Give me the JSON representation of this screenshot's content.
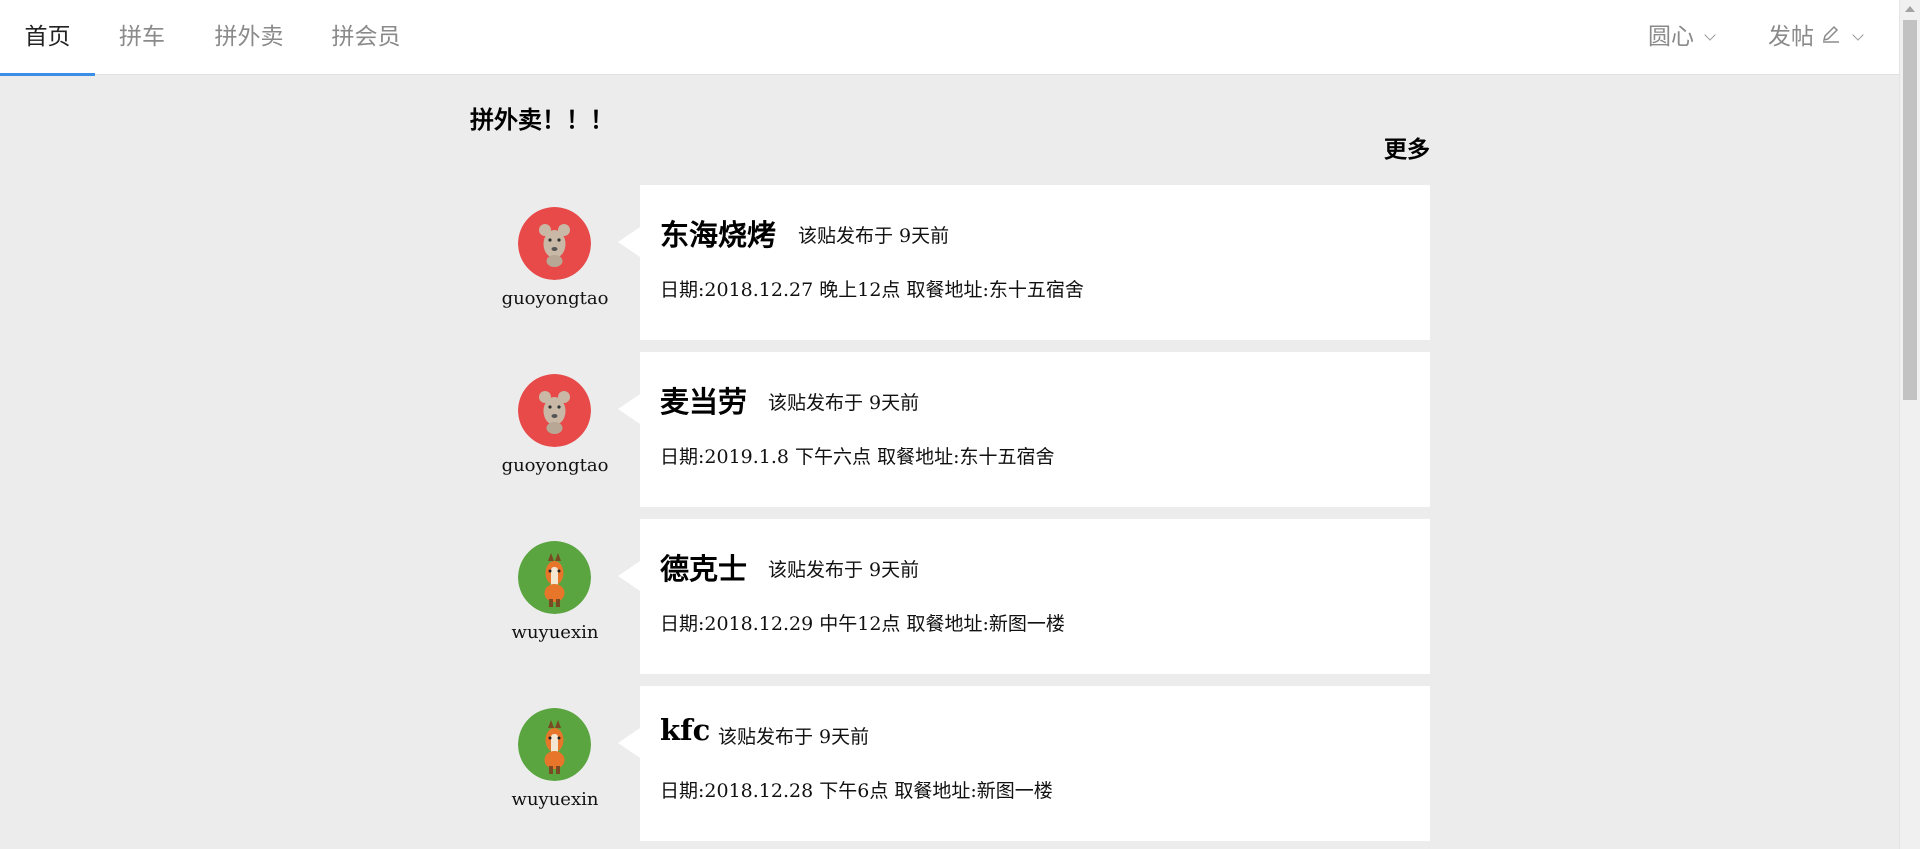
{
  "nav": {
    "tabs": [
      {
        "label": "首页",
        "active": true
      },
      {
        "label": "拼车",
        "active": false
      },
      {
        "label": "拼外卖",
        "active": false
      },
      {
        "label": "拼会员",
        "active": false
      }
    ],
    "right": {
      "circle_label": "圆心",
      "post_label": "发帖"
    },
    "accent_color": "#3a8ee6"
  },
  "section": {
    "title": "拼外卖！！！",
    "more_label": "更多"
  },
  "posts": [
    {
      "shop": "东海烧烤",
      "posted": "该贴发布于 9天前",
      "detail": "日期:2018.12.27 晚上12点 取餐地址:东十五宿舍",
      "username": "guoyongtao",
      "avatar_icon": "mouse-avatar-icon",
      "avatar_color": "#e84a4a"
    },
    {
      "shop": "麦当劳",
      "posted": "该贴发布于 9天前",
      "detail": "日期:2019.1.8 下午六点 取餐地址:东十五宿舍",
      "username": "guoyongtao",
      "avatar_icon": "mouse-avatar-icon",
      "avatar_color": "#e84a4a"
    },
    {
      "shop": "德克士",
      "posted": "该贴发布于 9天前",
      "detail": "日期:2018.12.29 中午12点 取餐地址:新图一楼",
      "username": "wuyuexin",
      "avatar_icon": "horse-avatar-icon",
      "avatar_color": "#5aa540"
    },
    {
      "shop": "kfc",
      "posted": "该贴发布于 9天前",
      "detail": "日期:2018.12.28 下午6点 取餐地址:新图一楼",
      "username": "wuyuexin",
      "avatar_icon": "horse-avatar-icon",
      "avatar_color": "#5aa540"
    }
  ]
}
